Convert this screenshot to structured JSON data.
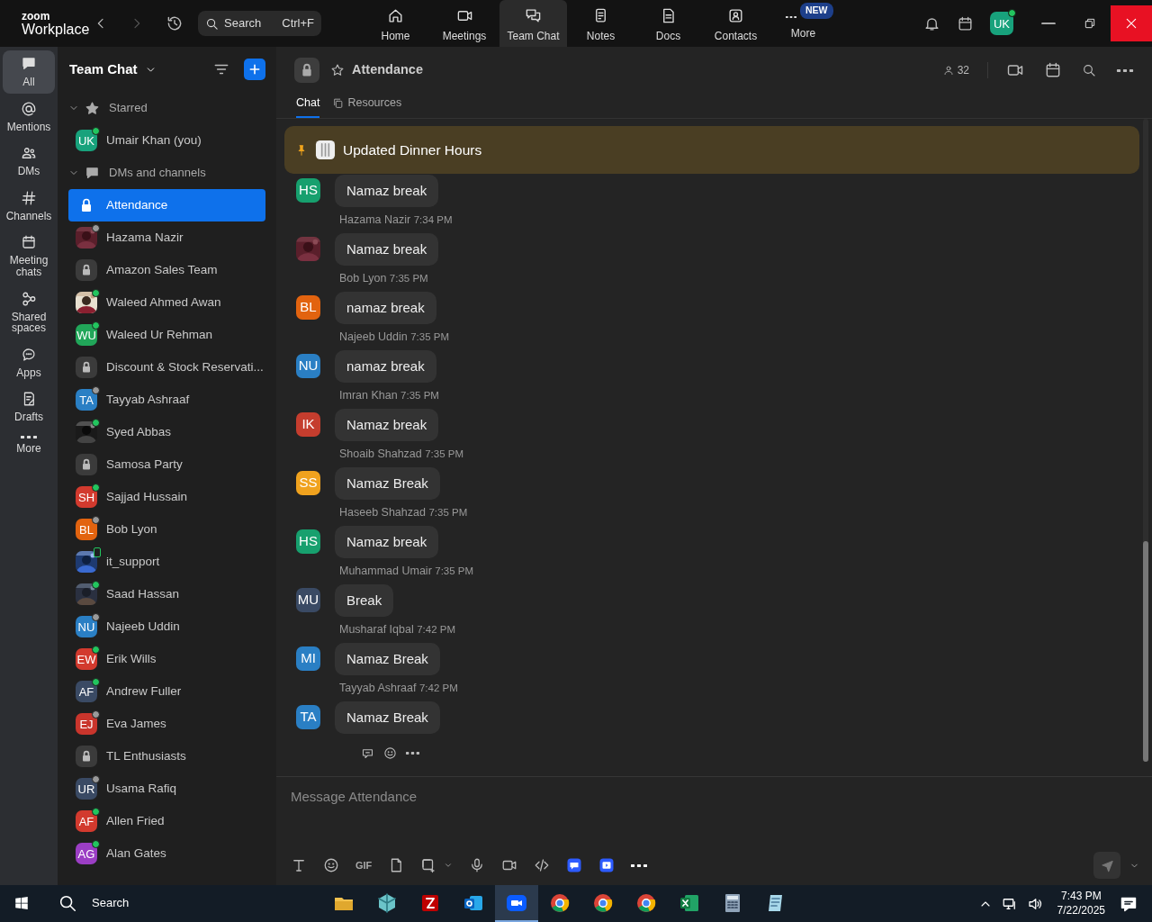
{
  "app_bar": {
    "logo_top": "zoom",
    "logo_bottom": "Workplace",
    "search": {
      "placeholder": "Search",
      "shortcut": "Ctrl+F"
    },
    "nav": [
      {
        "label": "Home",
        "selected": false
      },
      {
        "label": "Meetings",
        "selected": false
      },
      {
        "label": "Team Chat",
        "selected": true
      },
      {
        "label": "Notes",
        "selected": false
      },
      {
        "label": "Docs",
        "selected": false
      },
      {
        "label": "Contacts",
        "selected": false
      },
      {
        "label": "More",
        "selected": false,
        "badge": "NEW"
      }
    ],
    "user_avatar": {
      "initials": "UK",
      "color": "#18a27c",
      "online": true
    }
  },
  "rail": [
    {
      "label": "All",
      "selected": true
    },
    {
      "label": "Mentions",
      "selected": false
    },
    {
      "label": "DMs",
      "selected": false
    },
    {
      "label": "Channels",
      "selected": false
    },
    {
      "label": "Meeting chats",
      "selected": false
    },
    {
      "label": "Shared spaces",
      "selected": false
    },
    {
      "label": "Apps",
      "selected": false
    },
    {
      "label": "Drafts",
      "selected": false
    },
    {
      "label": "More",
      "selected": false
    }
  ],
  "sidebar": {
    "title": "Team Chat",
    "sections": [
      {
        "label": "Starred",
        "expanded": true,
        "items": [
          {
            "name": "Umair Khan (you)",
            "kind": "initials",
            "initials": "UK",
            "color": "#18a27c",
            "online": true,
            "selected": false
          }
        ]
      },
      {
        "label": "DMs and channels",
        "expanded": true,
        "items": [
          {
            "name": "Attendance",
            "kind": "channel",
            "selected": true
          },
          {
            "name": "Hazama Nazir",
            "kind": "picture",
            "online": false,
            "selected": false
          },
          {
            "name": "Amazon Sales Team",
            "kind": "channel",
            "selected": false
          },
          {
            "name": "Waleed Ahmed Awan",
            "kind": "picture",
            "online": true,
            "selected": false
          },
          {
            "name": "Waleed Ur Rehman",
            "kind": "initials",
            "initials": "WU",
            "color": "#21a659",
            "online": true,
            "selected": false
          },
          {
            "name": "Discount & Stock Reservati...",
            "kind": "channel",
            "selected": false
          },
          {
            "name": "Tayyab Ashraaf",
            "kind": "initials",
            "initials": "TA",
            "color": "#2a7fc4",
            "online": false,
            "selected": false
          },
          {
            "name": "Syed Abbas",
            "kind": "picture",
            "online": true,
            "selected": false
          },
          {
            "name": "Samosa Party",
            "kind": "channel",
            "selected": false
          },
          {
            "name": "Sajjad Hussain",
            "kind": "initials",
            "initials": "SH",
            "color": "#d23a2e",
            "online": true,
            "selected": false
          },
          {
            "name": "Bob Lyon",
            "kind": "initials",
            "initials": "BL",
            "color": "#e2630f",
            "online": false,
            "selected": false
          },
          {
            "name": "it_support",
            "kind": "picture",
            "online": true,
            "mobile": true,
            "selected": false
          },
          {
            "name": "Saad Hassan",
            "kind": "picture",
            "online": true,
            "selected": false
          },
          {
            "name": "Najeeb Uddin",
            "kind": "initials",
            "initials": "NU",
            "color": "#2a7fc4",
            "online": false,
            "selected": false
          },
          {
            "name": "Erik Wills",
            "kind": "initials",
            "initials": "EW",
            "color": "#d23a2e",
            "online": true,
            "selected": false
          },
          {
            "name": "Andrew Fuller",
            "kind": "initials",
            "initials": "AF",
            "color": "#3a4a64",
            "online": true,
            "selected": false
          },
          {
            "name": "Eva James",
            "kind": "initials",
            "initials": "EJ",
            "color": "#c9352c",
            "online": false,
            "selected": false
          },
          {
            "name": "TL Enthusiasts",
            "kind": "channel",
            "selected": false
          },
          {
            "name": "Usama Rafiq",
            "kind": "initials",
            "initials": "UR",
            "color": "#3a4a64",
            "online": false,
            "selected": false
          },
          {
            "name": "Allen Fried",
            "kind": "initials",
            "initials": "AF",
            "color": "#d23a2e",
            "online": true,
            "selected": false
          },
          {
            "name": "Alan Gates",
            "kind": "initials",
            "initials": "AG",
            "color": "#9b3ec4",
            "online": true,
            "selected": false
          }
        ]
      }
    ]
  },
  "channel": {
    "title": "Attendance",
    "member_count": "32",
    "tabs": [
      {
        "label": "Chat",
        "selected": true
      },
      {
        "label": "Resources",
        "selected": false
      }
    ],
    "pinned": "Updated Dinner Hours",
    "messages": [
      {
        "kind": "initials",
        "initials": "HS",
        "color": "#17a06e",
        "text": "Namaz break"
      },
      {
        "kind": "picture",
        "sender": "Hazama Nazir",
        "time": "7:34 PM",
        "text": "Namaz break"
      },
      {
        "kind": "initials",
        "initials": "BL",
        "color": "#e2630f",
        "sender": "Bob Lyon",
        "time": "7:35 PM",
        "text": "namaz break"
      },
      {
        "kind": "initials",
        "initials": "NU",
        "color": "#2a7fc4",
        "sender": "Najeeb Uddin",
        "time": "7:35 PM",
        "text": "namaz break"
      },
      {
        "kind": "initials",
        "initials": "IK",
        "color": "#c53d2e",
        "sender": "Imran Khan",
        "time": "7:35 PM",
        "text": "Namaz break"
      },
      {
        "kind": "initials",
        "initials": "SS",
        "color": "#f0a21e",
        "sender": "Shoaib Shahzad",
        "time": "7:35 PM",
        "text": "Namaz Break"
      },
      {
        "kind": "initials",
        "initials": "HS",
        "color": "#17a06e",
        "sender": "Haseeb Shahzad",
        "time": "7:35 PM",
        "text": "Namaz break"
      },
      {
        "kind": "initials",
        "initials": "MU",
        "color": "#3a4a64",
        "sender": "Muhammad Umair",
        "time": "7:35 PM",
        "text": "Break"
      },
      {
        "kind": "initials",
        "initials": "MI",
        "color": "#2a7fc4",
        "sender": "Musharaf Iqbal",
        "time": "7:42 PM",
        "text": "Namaz Break"
      },
      {
        "kind": "initials",
        "initials": "TA",
        "color": "#2a7fc4",
        "sender": "Tayyab Ashraaf",
        "time": "7:42 PM",
        "text": "Namaz Break"
      }
    ]
  },
  "composer": {
    "placeholder": "Message Attendance",
    "send_disabled": true,
    "gif_label": "GIF"
  },
  "taskbar": {
    "search": "Search",
    "apps": [
      {
        "selected": false
      },
      {
        "selected": false
      },
      {
        "selected": false
      },
      {
        "selected": false
      },
      {
        "selected": true
      },
      {
        "selected": false
      },
      {
        "selected": false
      },
      {
        "selected": false
      },
      {
        "selected": false
      },
      {
        "selected": false
      },
      {
        "selected": false
      }
    ],
    "time": "7:43 PM",
    "date": "7/22/2025"
  }
}
